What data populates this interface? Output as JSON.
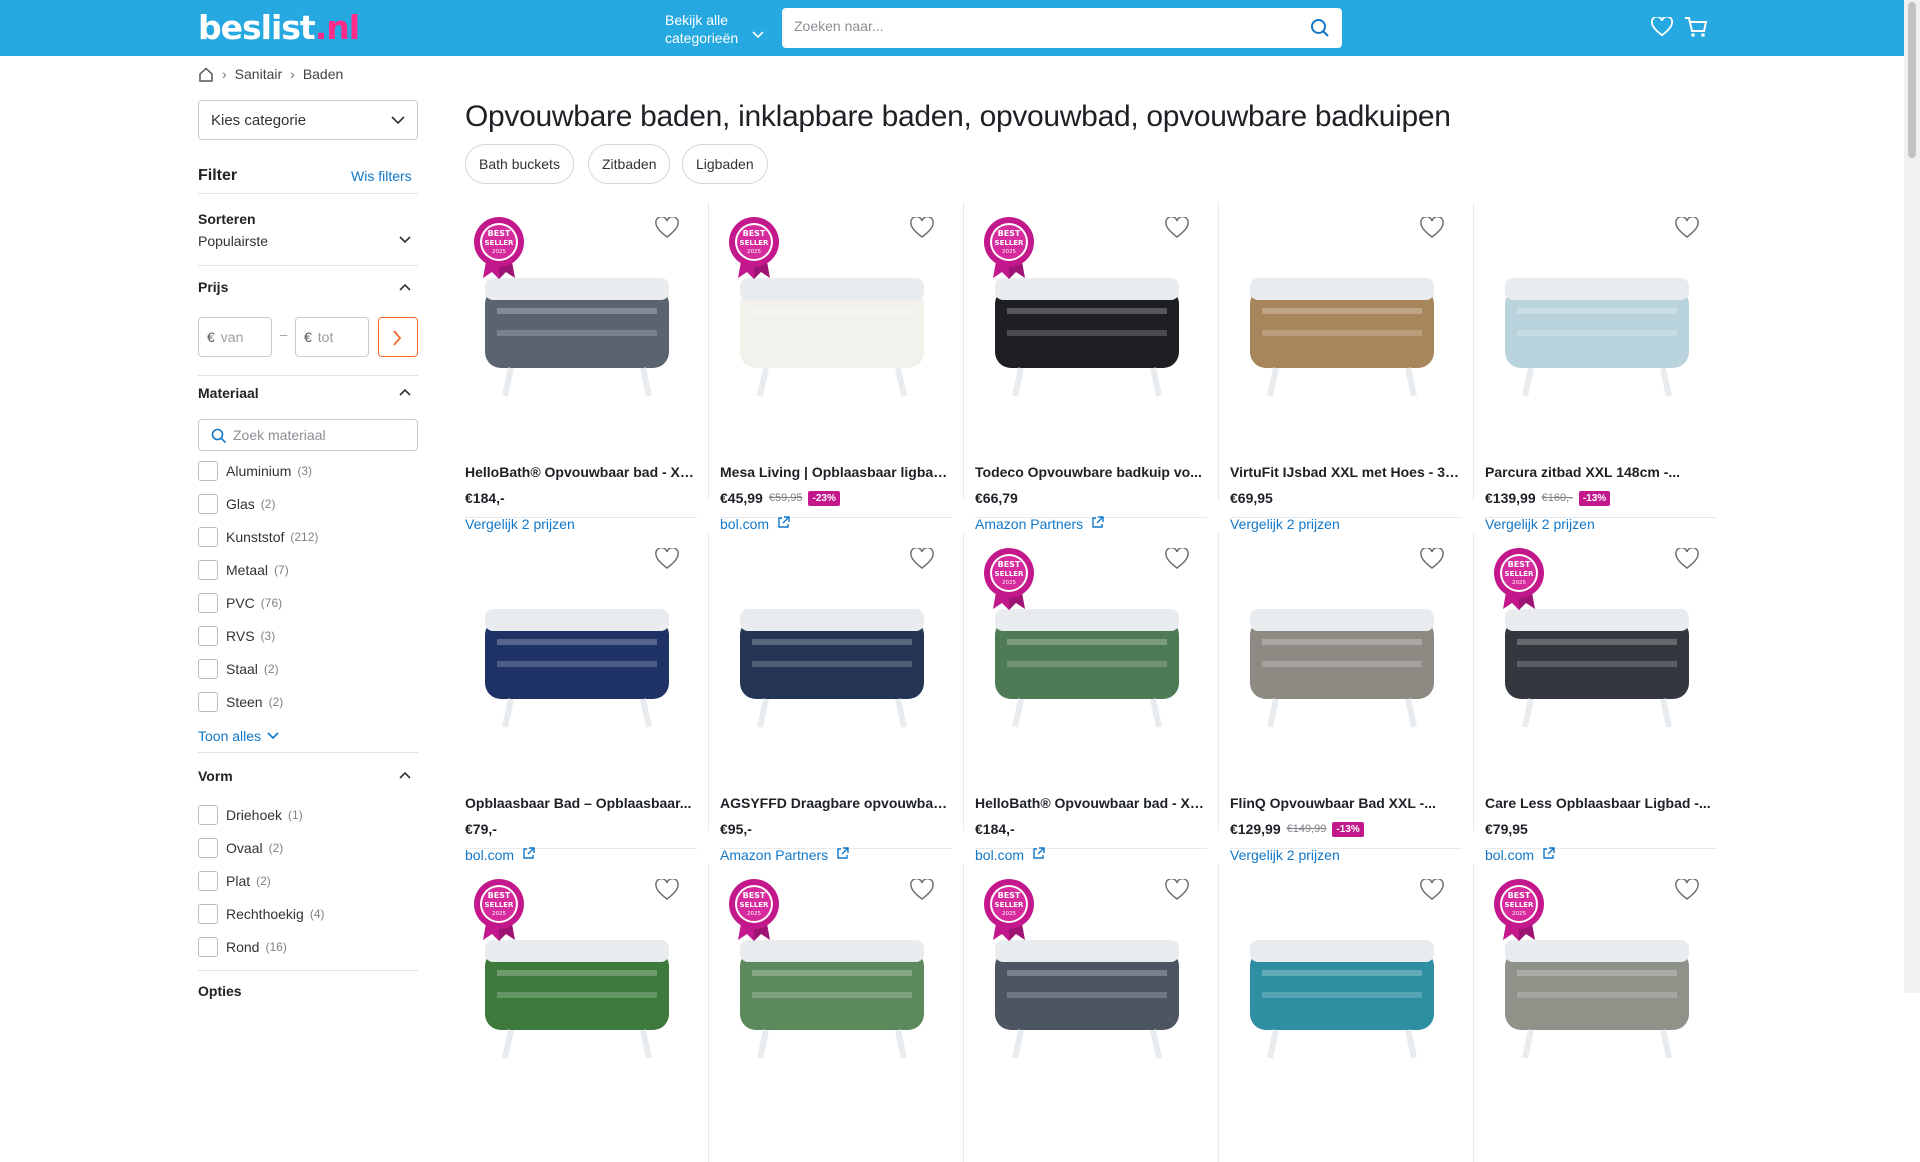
{
  "header": {
    "logo_main": "beslist",
    "logo_tld": ".nl",
    "categories_label_1": "Bekijk alle",
    "categories_label_2": "categorieën",
    "search_placeholder": "Zoeken naar..."
  },
  "breadcrumb": {
    "items": [
      "Sanitair",
      "Baden"
    ]
  },
  "sidebar": {
    "category_select": "Kies categorie",
    "filter_title": "Filter",
    "clear_filters": "Wis filters",
    "sort_label": "Sorteren",
    "sort_value": "Populairste",
    "price_title": "Prijs",
    "price_currency": "€",
    "price_from": "van",
    "price_to": "tot",
    "price_dash": "–",
    "material_title": "Materiaal",
    "material_search_placeholder": "Zoek materiaal",
    "materials": [
      {
        "label": "Aluminium",
        "count": "(3)"
      },
      {
        "label": "Glas",
        "count": "(2)"
      },
      {
        "label": "Kunststof",
        "count": "(212)"
      },
      {
        "label": "Metaal",
        "count": "(7)"
      },
      {
        "label": "PVC",
        "count": "(76)"
      },
      {
        "label": "RVS",
        "count": "(3)"
      },
      {
        "label": "Staal",
        "count": "(2)"
      },
      {
        "label": "Steen",
        "count": "(2)"
      }
    ],
    "show_all": "Toon alles",
    "shape_title": "Vorm",
    "shapes": [
      {
        "label": "Driehoek",
        "count": "(1)"
      },
      {
        "label": "Ovaal",
        "count": "(2)"
      },
      {
        "label": "Plat",
        "count": "(2)"
      },
      {
        "label": "Rechthoekig",
        "count": "(4)"
      },
      {
        "label": "Rond",
        "count": "(16)"
      }
    ],
    "options_title": "Opties"
  },
  "main": {
    "title": "Opvouwbare baden, inklapbare baden, opvouwbad, opvouwbare badkuipen",
    "chips": [
      "Bath buckets",
      "Zitbaden",
      "Ligbaden"
    ],
    "products": [
      {
        "name": "HelloBath® Opvouwbaar bad - XXL...",
        "price": "€184,-",
        "old": "",
        "disc": "",
        "shop": "Vergelijk 2 prijzen",
        "external": false,
        "bestseller": true,
        "color": "#5b6270"
      },
      {
        "name": "Mesa Living | Opblaasbaar ligbad ...",
        "price": "€45,99",
        "old": "€59,95",
        "disc": "-23%",
        "shop": "bol.com",
        "external": true,
        "bestseller": true,
        "color": "#f2f1ec"
      },
      {
        "name": "Todeco Opvouwbare badkuip vo...",
        "price": "€66,79",
        "old": "",
        "disc": "",
        "shop": "Amazon Partners",
        "external": true,
        "bestseller": true,
        "color": "#1e1f22"
      },
      {
        "name": "VirtuFit IJsbad XXL met Hoes - 37...",
        "price": "€69,95",
        "old": "",
        "disc": "",
        "shop": "Vergelijk 2 prijzen",
        "external": false,
        "bestseller": false,
        "color": "#a8865c"
      },
      {
        "name": "Parcura zitbad XXL 148cm -...",
        "price": "€139,99",
        "old": "€160,-",
        "disc": "-13%",
        "shop": "Vergelijk 2 prijzen",
        "external": false,
        "bestseller": false,
        "color": "#b9d3dc"
      },
      {
        "name": "Opblaasbaar Bad – Opblaasbaar...",
        "price": "€79,-",
        "old": "",
        "disc": "",
        "shop": "bol.com",
        "external": true,
        "bestseller": false,
        "color": "#1f3265"
      },
      {
        "name": "AGSYFFD Draagbare opvouwbare...",
        "price": "€95,-",
        "old": "",
        "disc": "",
        "shop": "Amazon Partners",
        "external": true,
        "bestseller": false,
        "color": "#243553"
      },
      {
        "name": "HelloBath® Opvouwbaar bad - XXL...",
        "price": "€184,-",
        "old": "",
        "disc": "",
        "shop": "bol.com",
        "external": true,
        "bestseller": true,
        "color": "#4f7a56"
      },
      {
        "name": "FlinQ Opvouwbaar Bad XXL -...",
        "price": "€129,99",
        "old": "€149,99",
        "disc": "-13%",
        "shop": "Vergelijk 2 prijzen",
        "external": false,
        "bestseller": false,
        "color": "#8d8a84"
      },
      {
        "name": "Care Less Opblaasbaar Ligbad -...",
        "price": "€79,95",
        "old": "",
        "disc": "",
        "shop": "bol.com",
        "external": true,
        "bestseller": true,
        "color": "#33383f"
      },
      {
        "name": "",
        "price": "",
        "old": "",
        "disc": "",
        "shop": "",
        "external": false,
        "bestseller": true,
        "color": "#3e7a3c"
      },
      {
        "name": "",
        "price": "",
        "old": "",
        "disc": "",
        "shop": "",
        "external": false,
        "bestseller": true,
        "color": "#5c8a5c"
      },
      {
        "name": "",
        "price": "",
        "old": "",
        "disc": "",
        "shop": "",
        "external": false,
        "bestseller": true,
        "color": "#4d5563"
      },
      {
        "name": "",
        "price": "",
        "old": "",
        "disc": "",
        "shop": "",
        "external": false,
        "bestseller": false,
        "color": "#2e8fa2"
      },
      {
        "name": "",
        "price": "",
        "old": "",
        "disc": "",
        "shop": "",
        "external": false,
        "bestseller": true,
        "color": "#8e9289"
      }
    ],
    "badge": {
      "line1": "BEST",
      "line2": "SELLER",
      "line3": "2025"
    }
  },
  "colors": {
    "header": "#26a9e0",
    "link": "#1277c8",
    "accent": "#f46a2e",
    "badge": "#c2188b"
  }
}
